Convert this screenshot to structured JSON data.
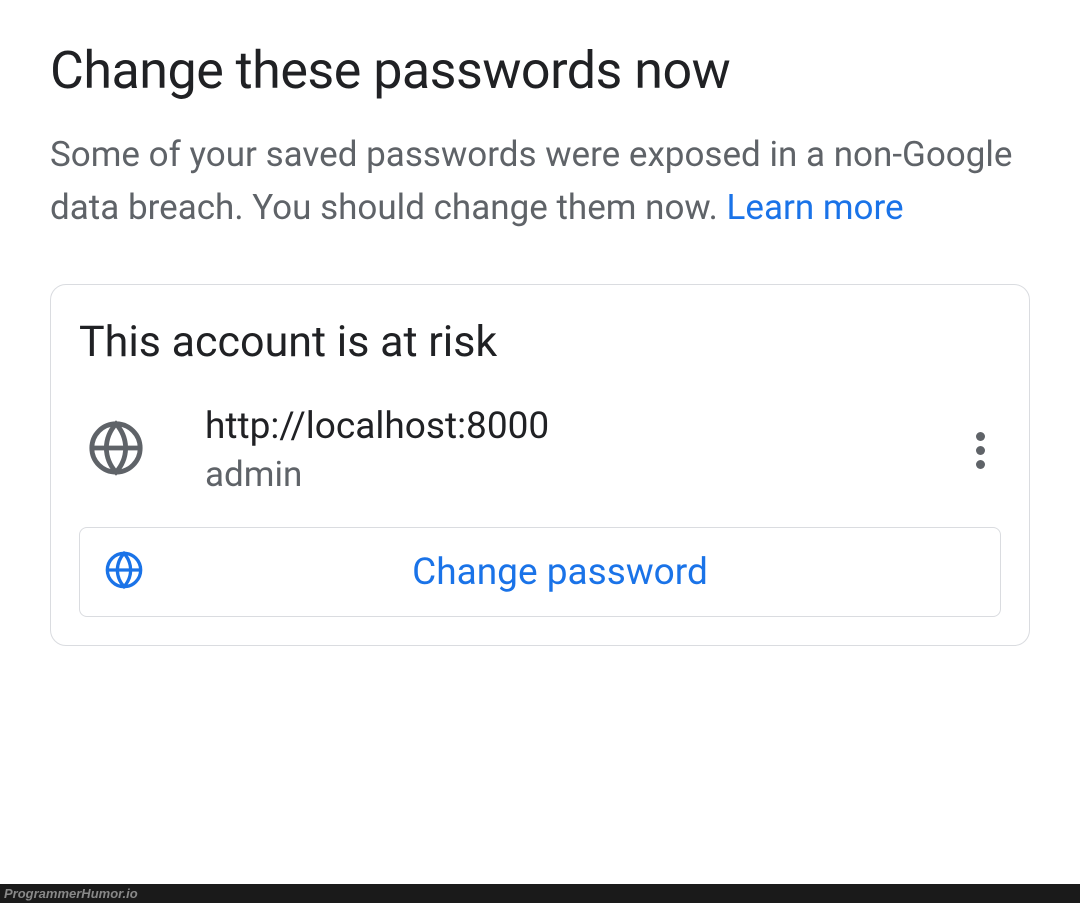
{
  "header": {
    "title": "Change these passwords now",
    "description": "Some of your saved passwords were exposed in a non-Google data breach. You should change them now. ",
    "learn_more_label": "Learn more"
  },
  "card": {
    "title": "This account is at risk",
    "account": {
      "site_url": "http://localhost:8000",
      "username": "admin"
    },
    "change_button_label": "Change password"
  },
  "watermark": "ProgrammerHumor.io"
}
